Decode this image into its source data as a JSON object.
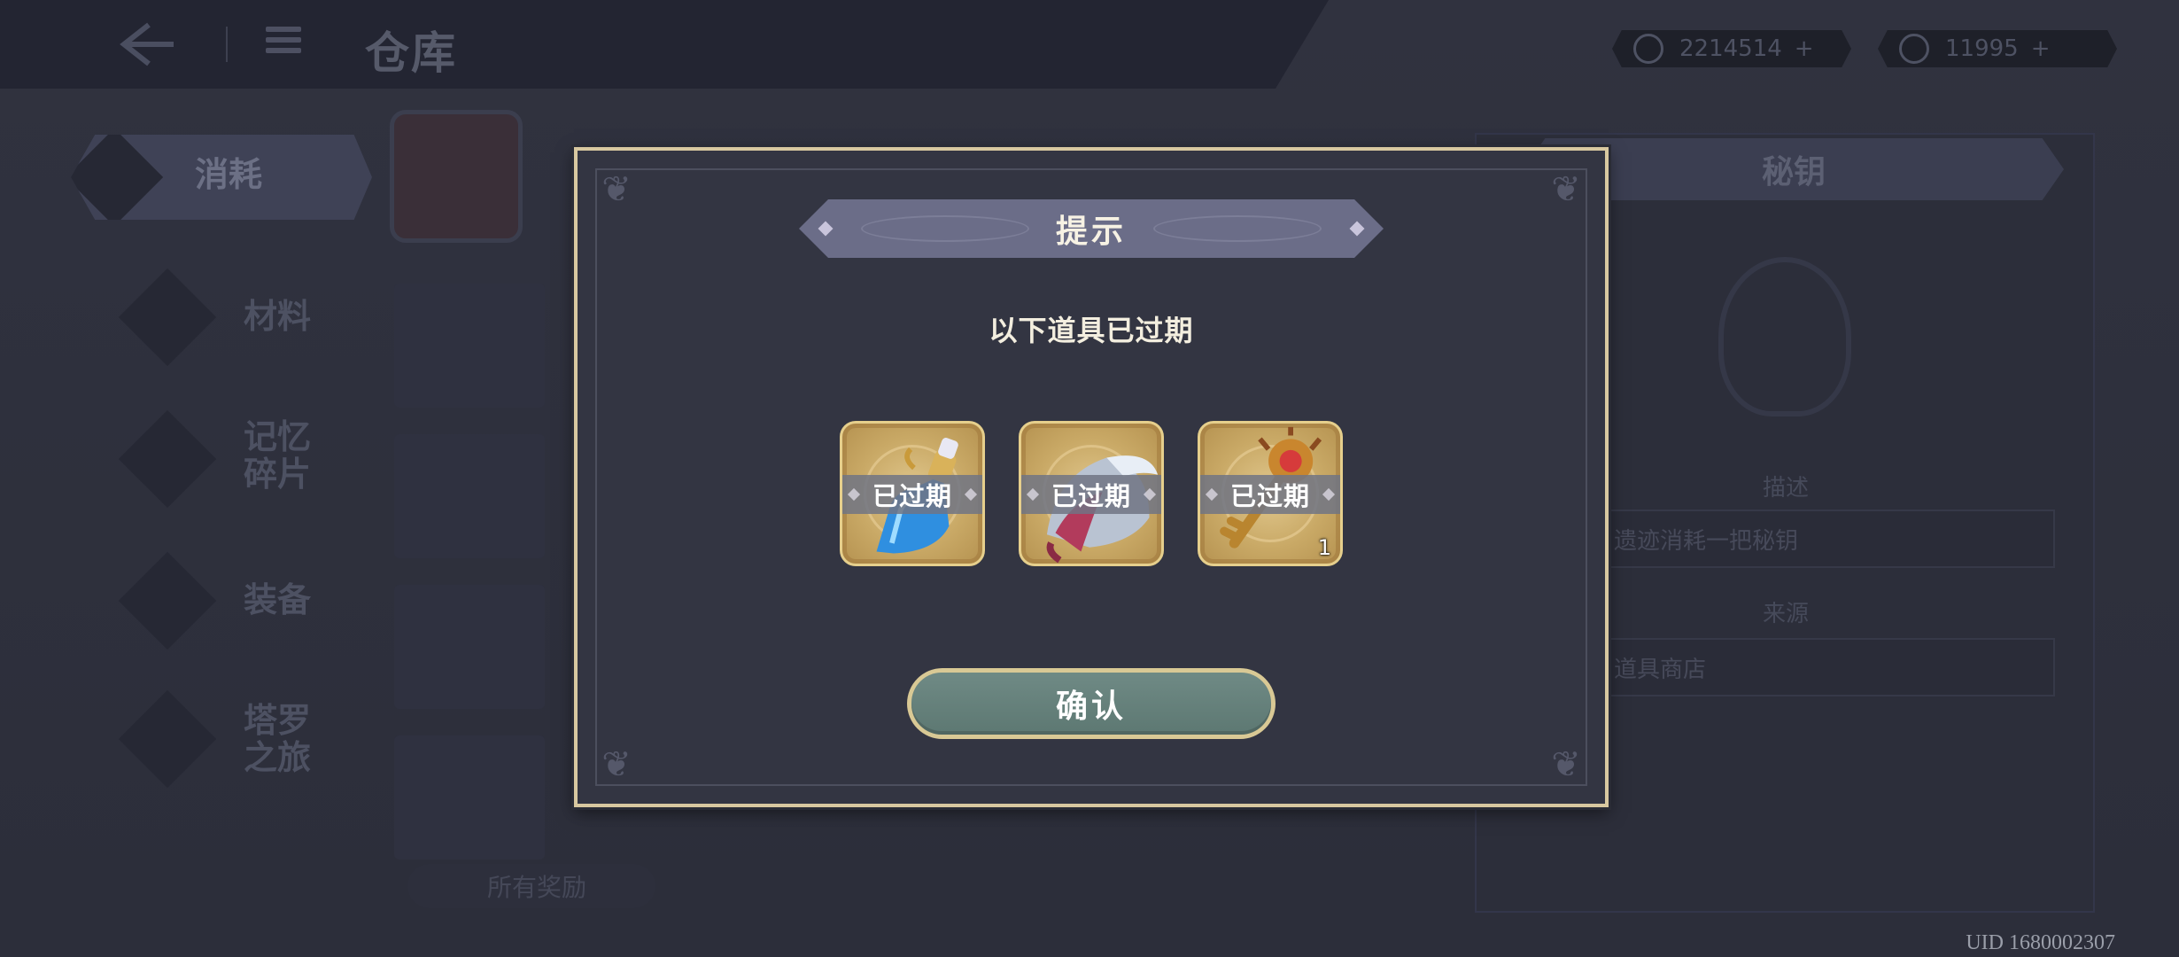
{
  "header": {
    "title": "仓库",
    "currency_1": {
      "value": "2214514",
      "plus": "+"
    },
    "currency_2": {
      "value": "11995",
      "plus": "+"
    }
  },
  "sidebar": {
    "items": [
      {
        "label": "消耗",
        "active": true
      },
      {
        "label": "材料"
      },
      {
        "label": "记忆\n碎片"
      },
      {
        "label": "装备"
      },
      {
        "label": "塔罗\n之旅"
      }
    ]
  },
  "filter": {
    "label": "所有奖励"
  },
  "detail": {
    "title": "秘钥",
    "desc_label": "描述",
    "desc_text": "遗迹消耗一把秘钥",
    "source_label": "来源",
    "source_text": "道具商店"
  },
  "dialog": {
    "title": "提示",
    "message": "以下道具已过期",
    "items": [
      {
        "name": "blue-potion",
        "status": "已过期",
        "count": ""
      },
      {
        "name": "helmet",
        "status": "已过期",
        "count": ""
      },
      {
        "name": "key",
        "status": "已过期",
        "count": "1"
      }
    ],
    "confirm_label": "确认"
  },
  "footer": {
    "uid": "UID 1680002307"
  },
  "colors": {
    "dialog_border": "#d8c8a0",
    "banner": "#6b6d88",
    "confirm_button": "#6f8a85",
    "item_card_gold": "#c9a966"
  }
}
